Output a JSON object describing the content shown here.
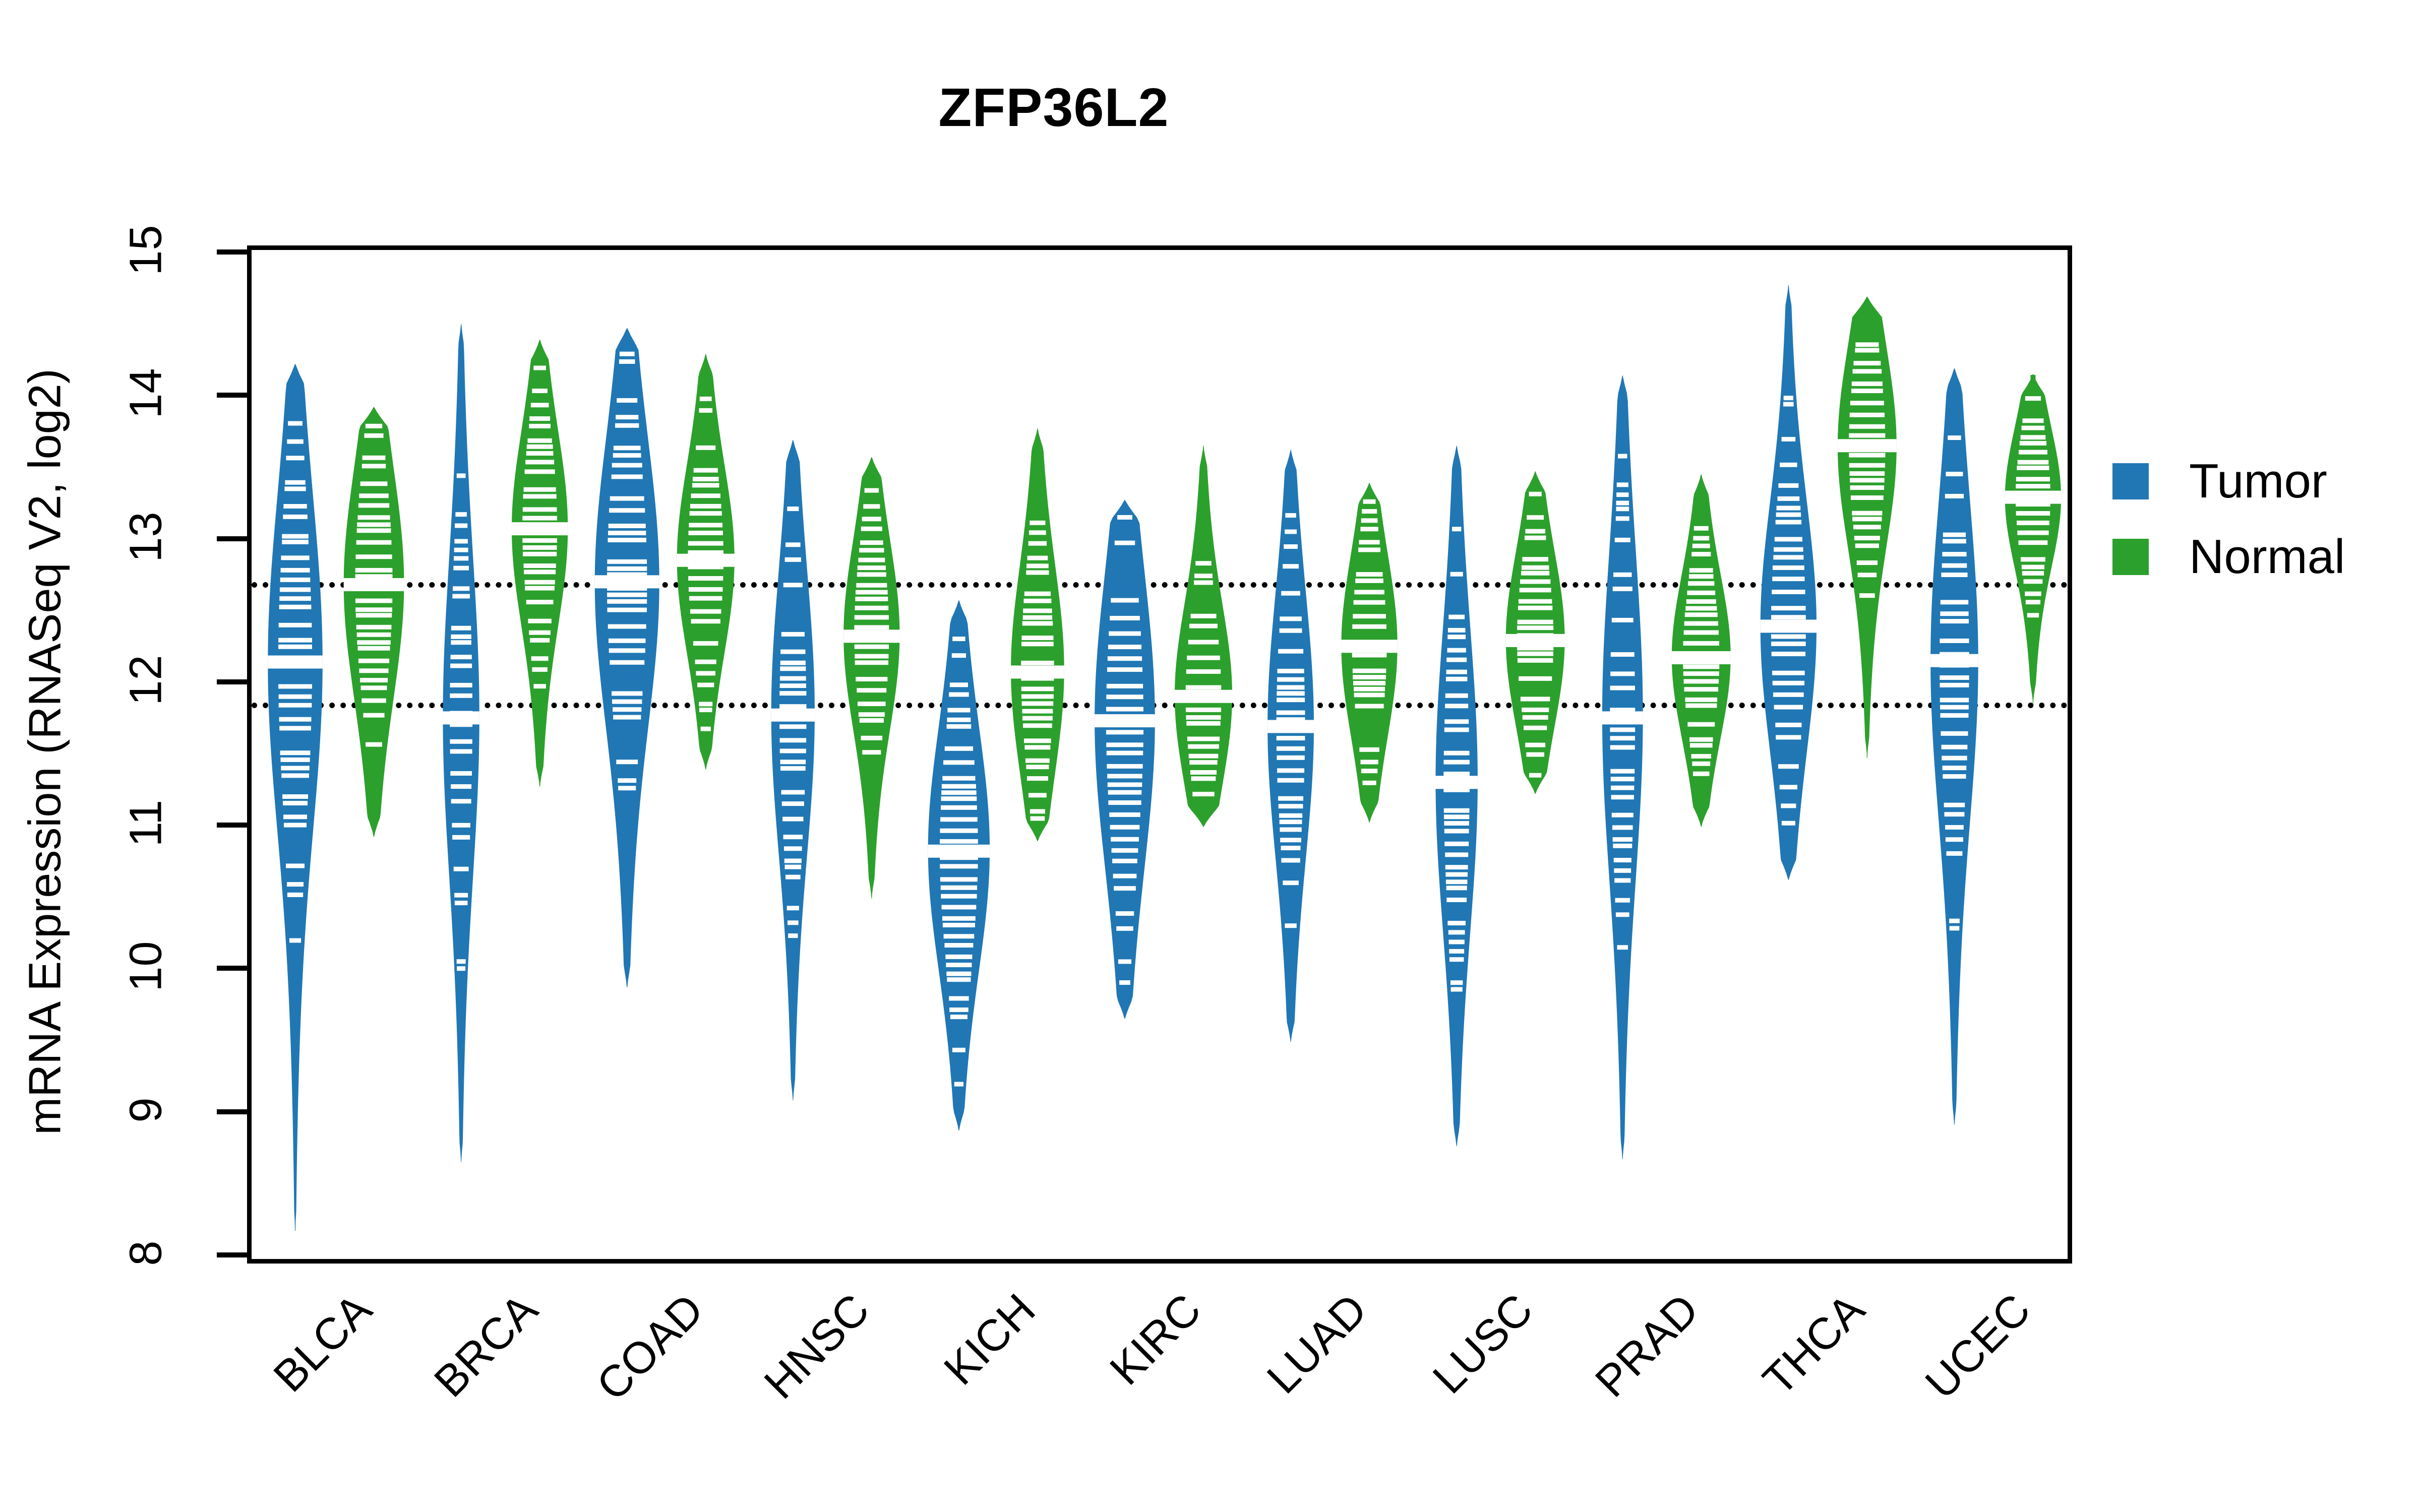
{
  "chart_data": {
    "type": "violin",
    "title": "ZFP36L2",
    "xlabel": "",
    "ylabel": "mRNA Expression (RNASeq V2, log2)",
    "ylim": [
      8,
      15
    ],
    "yticks": [
      8,
      9,
      10,
      11,
      12,
      13,
      14,
      15
    ],
    "ytick_labels": [
      "8",
      "9",
      "10",
      "11",
      "12",
      "13",
      "14",
      "15"
    ],
    "grid": false,
    "legend_position": "right",
    "reference_lines": [
      12.71,
      11.87
    ],
    "colors": {
      "tumor": "#2077B4",
      "normal": "#2CA02C",
      "axis": "#000000"
    },
    "legend": [
      {
        "label": "Tumor",
        "color": "#2077B4"
      },
      {
        "label": "Normal",
        "color": "#2CA02C"
      }
    ],
    "categories": [
      "BLCA",
      "BRCA",
      "COAD",
      "HNSC",
      "KICH",
      "KIRC",
      "LUAD",
      "LUSC",
      "PRAD",
      "THCA",
      "UCEC"
    ],
    "series": [
      {
        "name": "Tumor",
        "color": "#2077B4",
        "values": [
          {
            "category": "BLCA",
            "median": 12.17,
            "q1": 11.45,
            "q3": 12.78,
            "min": 8.2,
            "max": 14.25,
            "width": 0.78
          },
          {
            "category": "BRCA",
            "median": 11.78,
            "q1": 11.18,
            "q3": 12.45,
            "min": 8.68,
            "max": 14.53,
            "width": 0.52
          },
          {
            "category": "COAD",
            "median": 12.73,
            "q1": 12.1,
            "q3": 13.25,
            "min": 9.9,
            "max": 14.5,
            "width": 0.92
          },
          {
            "category": "HNSC",
            "median": 11.8,
            "q1": 11.32,
            "q3": 12.45,
            "min": 9.11,
            "max": 13.72,
            "width": 0.62
          },
          {
            "category": "KICH",
            "median": 10.85,
            "q1": 10.45,
            "q3": 11.42,
            "min": 8.9,
            "max": 12.6,
            "width": 0.88
          },
          {
            "category": "KIRC",
            "median": 11.76,
            "q1": 11.2,
            "q3": 12.38,
            "min": 9.68,
            "max": 13.3,
            "width": 0.86
          },
          {
            "category": "LUAD",
            "median": 11.72,
            "q1": 11.22,
            "q3": 12.28,
            "min": 9.52,
            "max": 13.65,
            "width": 0.66
          },
          {
            "category": "LUSC",
            "median": 11.33,
            "q1": 10.82,
            "q3": 12.02,
            "min": 8.79,
            "max": 13.68,
            "width": 0.6
          },
          {
            "category": "PRAD",
            "median": 11.78,
            "q1": 11.22,
            "q3": 12.52,
            "min": 8.7,
            "max": 14.17,
            "width": 0.58
          },
          {
            "category": "THCA",
            "median": 12.42,
            "q1": 11.9,
            "q3": 12.9,
            "min": 10.65,
            "max": 14.8,
            "width": 0.8
          },
          {
            "category": "UCEC",
            "median": 12.18,
            "q1": 11.52,
            "q3": 12.8,
            "min": 8.94,
            "max": 14.22,
            "width": 0.68
          }
        ]
      },
      {
        "name": "Normal",
        "color": "#2CA02C",
        "values": [
          {
            "category": "BLCA",
            "median": 12.71,
            "q1": 12.3,
            "q3": 13.22,
            "min": 10.95,
            "max": 13.95,
            "width": 0.86
          },
          {
            "category": "BRCA",
            "median": 13.1,
            "q1": 12.72,
            "q3": 13.5,
            "min": 11.3,
            "max": 14.42,
            "width": 0.8
          },
          {
            "category": "COAD",
            "median": 12.88,
            "q1": 12.55,
            "q3": 13.3,
            "min": 11.42,
            "max": 14.32,
            "width": 0.82
          },
          {
            "category": "HNSC",
            "median": 12.35,
            "q1": 12.02,
            "q3": 12.78,
            "min": 10.52,
            "max": 13.6,
            "width": 0.8
          },
          {
            "category": "KICH",
            "median": 12.1,
            "q1": 11.78,
            "q3": 12.62,
            "min": 10.92,
            "max": 13.8,
            "width": 0.76
          },
          {
            "category": "KIRC",
            "median": 11.93,
            "q1": 11.62,
            "q3": 12.35,
            "min": 11.02,
            "max": 13.68,
            "width": 0.82
          },
          {
            "category": "LUAD",
            "median": 12.28,
            "q1": 11.95,
            "q3": 12.68,
            "min": 11.05,
            "max": 13.42,
            "width": 0.8
          },
          {
            "category": "LUSC",
            "median": 12.32,
            "q1": 12.02,
            "q3": 12.72,
            "min": 11.25,
            "max": 13.5,
            "width": 0.84
          },
          {
            "category": "PRAD",
            "median": 12.2,
            "q1": 11.92,
            "q3": 12.58,
            "min": 11.02,
            "max": 13.48,
            "width": 0.84
          },
          {
            "category": "THCA",
            "median": 13.68,
            "q1": 13.25,
            "q3": 14.05,
            "min": 11.5,
            "max": 14.72,
            "width": 0.84
          },
          {
            "category": "UCEC",
            "median": 13.32,
            "q1": 13.02,
            "q3": 13.58,
            "min": 11.88,
            "max": 14.18,
            "width": 0.8
          }
        ]
      }
    ]
  }
}
